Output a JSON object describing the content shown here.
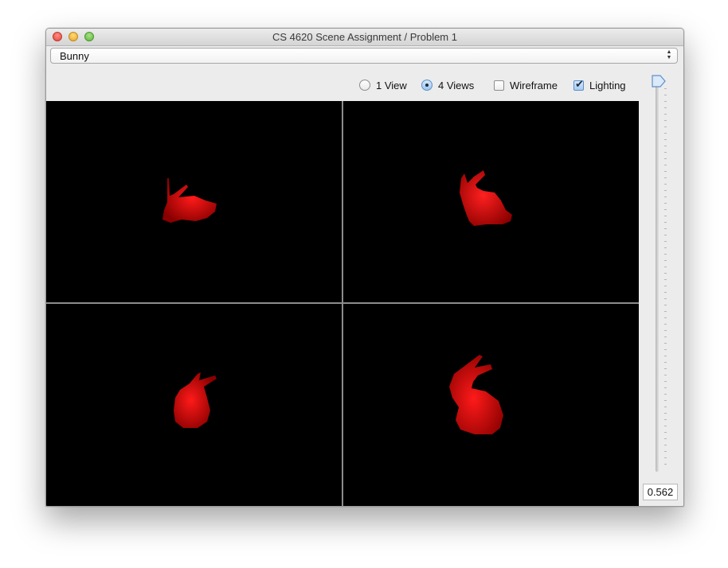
{
  "window": {
    "title": "CS 4620 Scene Assignment / Problem 1"
  },
  "scene_selector": {
    "selected": "Bunny"
  },
  "view_options": {
    "one_view_label": "1 View",
    "four_views_label": "4 Views",
    "wireframe_label": "Wireframe",
    "lighting_label": "Lighting",
    "selected_view": "4 Views",
    "wireframe_checked": false,
    "lighting_checked": true
  },
  "slider": {
    "value_text": "0.562",
    "value": 0.562
  },
  "colors": {
    "model": "#ff0000",
    "background": "#000000",
    "divider": "#8c8c8c",
    "accent": "#5b8fcd"
  },
  "icons": {
    "combo_arrows": "up-down-arrows-icon",
    "slider_thumb": "slider-thumb-icon"
  }
}
